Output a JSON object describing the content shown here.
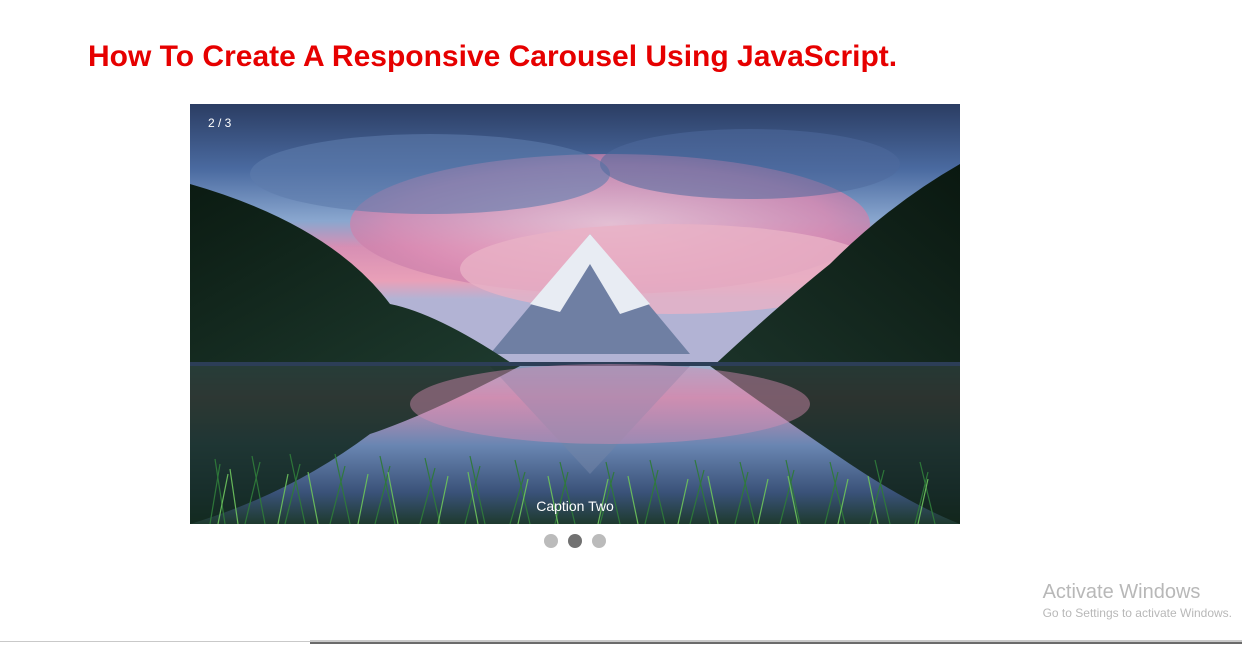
{
  "title": "How To Create A Responsive Carousel Using JavaScript.",
  "carousel": {
    "current": 2,
    "total": 3,
    "counter": "2 / 3",
    "caption": "Caption Two",
    "dots": [
      {
        "active": false
      },
      {
        "active": true
      },
      {
        "active": false
      }
    ]
  },
  "watermark": {
    "title": "Activate Windows",
    "subtitle": "Go to Settings to activate Windows."
  }
}
